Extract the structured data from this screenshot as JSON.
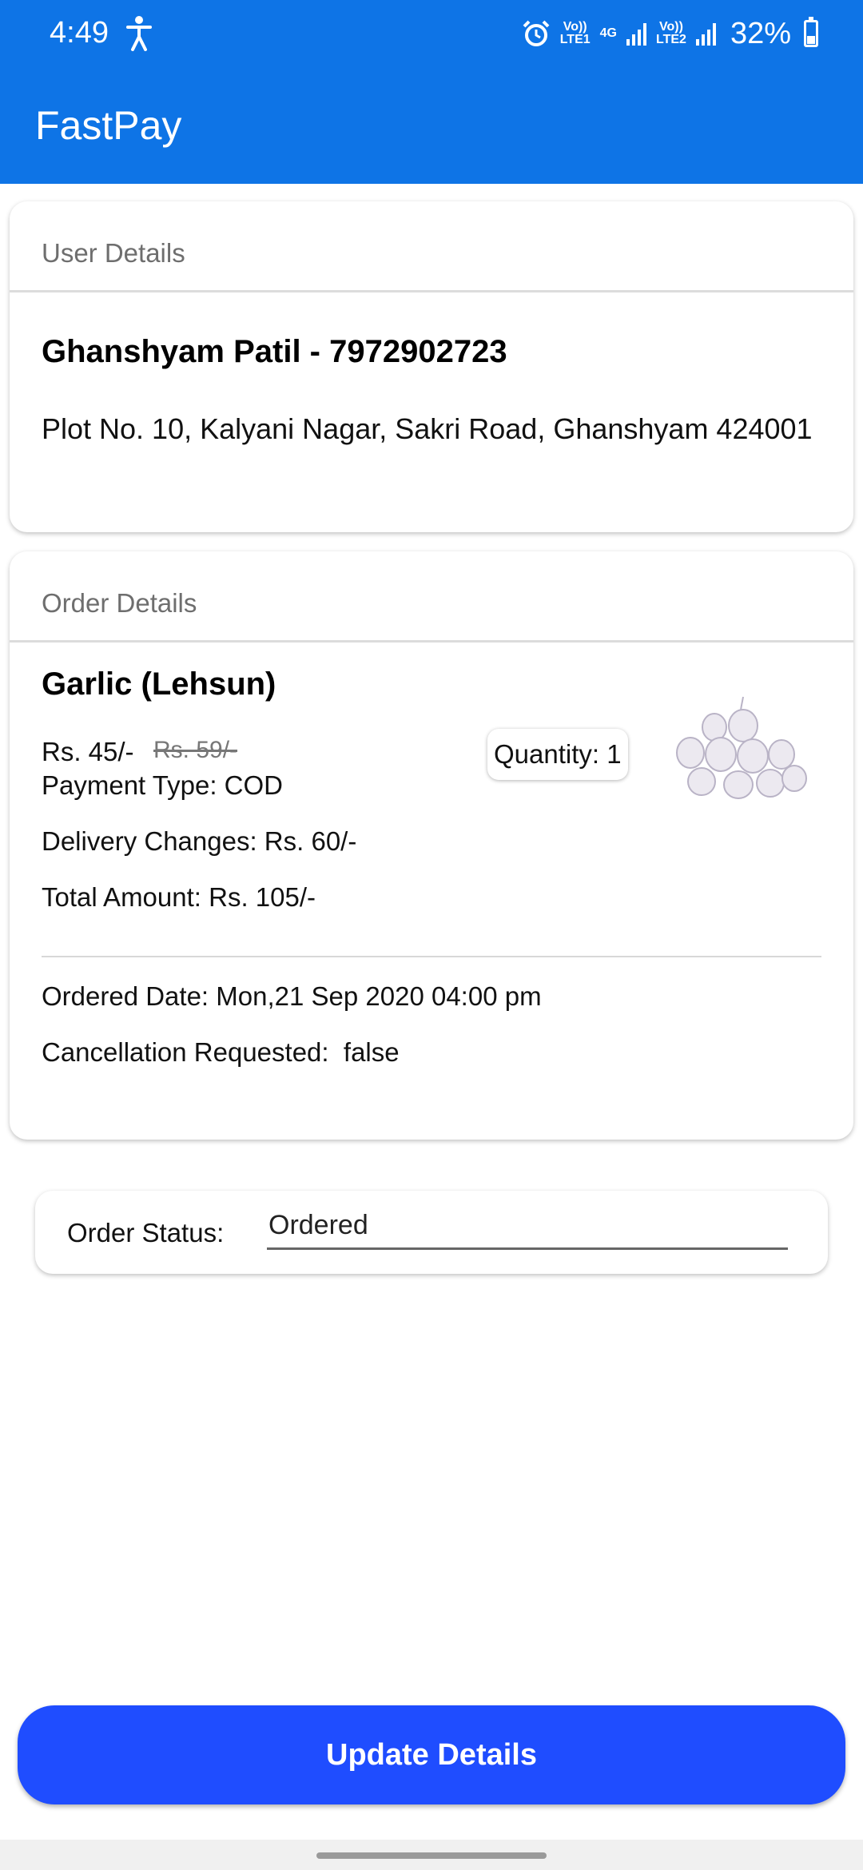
{
  "status_bar": {
    "time": "4:49",
    "sim1_top": "Vo))",
    "sim1_bottom": "LTE1",
    "network": "4G",
    "sim2_top": "Vo))",
    "sim2_bottom": "LTE2",
    "battery": "32%"
  },
  "app": {
    "title": "FastPay"
  },
  "user_details": {
    "header": "User Details",
    "name_phone": "Ghanshyam Patil - 7972902723",
    "address": "Plot No. 10, Kalyani Nagar, Sakri Road, Ghanshyam 424001"
  },
  "order_details": {
    "header": "Order Details",
    "product_name": "Garlic (Lehsun)",
    "price": "Rs. 45/-",
    "mrp": "Rs. 59/-",
    "quantity": "Quantity: 1",
    "payment_type": "Payment Type: COD",
    "delivery_charges": "Delivery Changes: Rs. 60/-",
    "total_amount": "Total Amount: Rs. 105/-",
    "ordered_date": "Ordered Date: Mon,21 Sep 2020 04:00 pm",
    "cancellation": "Cancellation Requested:  false"
  },
  "order_status": {
    "label": "Order Status:",
    "value": "Ordered"
  },
  "actions": {
    "update_label": "Update Details"
  },
  "colors": {
    "primary": "#0e74e6",
    "button": "#1f4dff"
  },
  "icons": [
    "accessibility-icon",
    "alarm-icon",
    "signal-icon",
    "battery-icon",
    "garlic-image"
  ]
}
